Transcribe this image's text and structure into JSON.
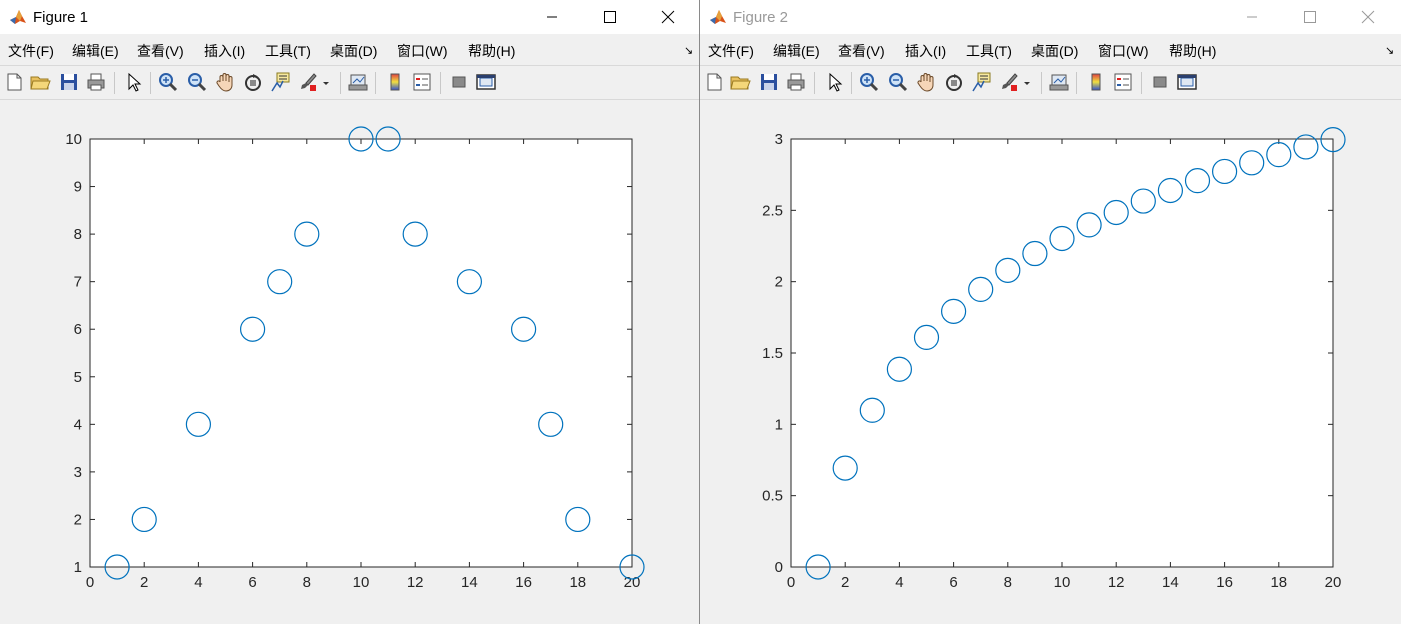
{
  "windows": [
    {
      "title": "Figure 1",
      "menu": [
        "文件(F)",
        "编辑(E)",
        "查看(V)",
        "插入(I)",
        "工具(T)",
        "桌面(D)",
        "窗口(W)",
        "帮助(H)"
      ],
      "toolbar_icons": [
        "new-figure-icon",
        "open-file-icon",
        "save-icon",
        "print-icon",
        "select-arrow-icon",
        "zoom-in-icon",
        "zoom-out-icon",
        "pan-hand-icon",
        "rotate-3d-icon",
        "data-cursor-icon",
        "brush-icon",
        "brush-dropdown-icon",
        "link-plot-icon",
        "colorbar-icon",
        "legend-icon",
        "hide-plot-tools-icon",
        "show-plot-tools-icon"
      ]
    },
    {
      "title": "Figure 2",
      "menu": [
        "文件(F)",
        "编辑(E)",
        "查看(V)",
        "插入(I)",
        "工具(T)",
        "桌面(D)",
        "窗口(W)",
        "帮助(H)"
      ],
      "toolbar_icons": [
        "new-figure-icon",
        "open-file-icon",
        "save-icon",
        "print-icon",
        "select-arrow-icon",
        "zoom-in-icon",
        "zoom-out-icon",
        "pan-hand-icon",
        "rotate-3d-icon",
        "data-cursor-icon",
        "brush-icon",
        "brush-dropdown-icon",
        "link-plot-icon",
        "colorbar-icon",
        "legend-icon",
        "hide-plot-tools-icon",
        "show-plot-tools-icon"
      ]
    }
  ],
  "colors": {
    "marker": "#0072bd",
    "axes": "#262626",
    "background": "#f0f0f0"
  },
  "chart_data": [
    {
      "type": "scatter",
      "marker": "circle-open",
      "x": [
        1,
        2,
        4,
        6,
        7,
        8,
        10,
        11,
        12,
        14,
        16,
        17,
        18,
        20
      ],
      "y": [
        1,
        2,
        4,
        6,
        7,
        8,
        10,
        10,
        8,
        7,
        6,
        4,
        2,
        1
      ],
      "xlim": [
        0,
        20
      ],
      "ylim": [
        1,
        10
      ],
      "xticks": [
        0,
        2,
        4,
        6,
        8,
        10,
        12,
        14,
        16,
        18,
        20
      ],
      "yticks": [
        1,
        2,
        3,
        4,
        5,
        6,
        7,
        8,
        9,
        10
      ],
      "xtick_labels": [
        "0",
        "2",
        "4",
        "6",
        "8",
        "10",
        "12",
        "14",
        "16",
        "18",
        "20"
      ],
      "ytick_labels": [
        "1",
        "2",
        "3",
        "4",
        "5",
        "6",
        "7",
        "8",
        "9",
        "10"
      ],
      "grid": false
    },
    {
      "type": "scatter",
      "marker": "circle-open",
      "x": [
        1,
        2,
        3,
        4,
        5,
        6,
        7,
        8,
        9,
        10,
        11,
        12,
        13,
        14,
        15,
        16,
        17,
        18,
        19,
        20
      ],
      "y": [
        0,
        0.6931,
        1.0986,
        1.3863,
        1.6094,
        1.7918,
        1.9459,
        2.0794,
        2.1972,
        2.3026,
        2.3979,
        2.4849,
        2.5649,
        2.6391,
        2.7081,
        2.7726,
        2.8332,
        2.8904,
        2.9444,
        2.9957
      ],
      "xlim": [
        0,
        20
      ],
      "ylim": [
        0,
        3
      ],
      "xticks": [
        0,
        2,
        4,
        6,
        8,
        10,
        12,
        14,
        16,
        18,
        20
      ],
      "yticks": [
        0,
        0.5,
        1,
        1.5,
        2,
        2.5,
        3
      ],
      "xtick_labels": [
        "0",
        "2",
        "4",
        "6",
        "8",
        "10",
        "12",
        "14",
        "16",
        "18",
        "20"
      ],
      "ytick_labels": [
        "0",
        "0.5",
        "1",
        "1.5",
        "2",
        "2.5",
        "3"
      ],
      "grid": false
    }
  ]
}
